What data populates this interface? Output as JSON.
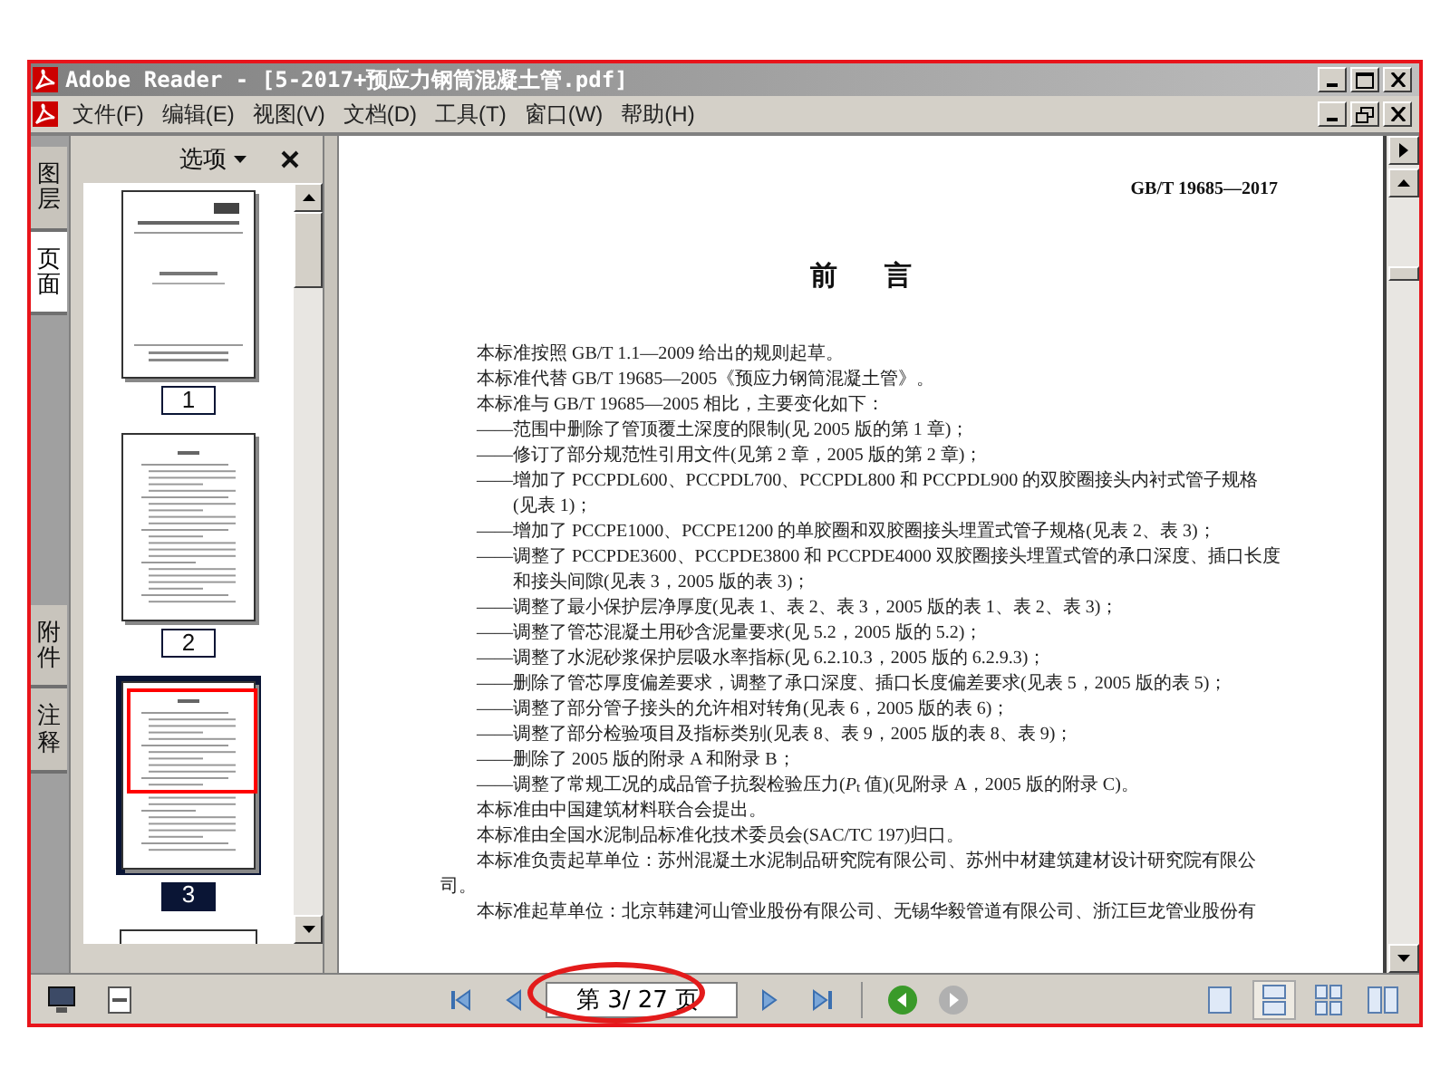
{
  "window": {
    "title": "Adobe Reader - [5-2017+预应力钢筒混凝土管.pdf]"
  },
  "menu": [
    "文件(F)",
    "编辑(E)",
    "视图(V)",
    "文档(D)",
    "工具(T)",
    "窗口(W)",
    "帮助(H)"
  ],
  "side_tabs": [
    {
      "label": "图层",
      "selected": false
    },
    {
      "label": "页面",
      "selected": true
    },
    {
      "label": "附件",
      "selected": false
    },
    {
      "label": "注释",
      "selected": false
    }
  ],
  "panel": {
    "options": "选项"
  },
  "thumbnails": [
    {
      "label": "1",
      "selected": false,
      "kind": "cover"
    },
    {
      "label": "2",
      "selected": false,
      "kind": "contents"
    },
    {
      "label": "3",
      "selected": true,
      "kind": "text"
    }
  ],
  "document": {
    "header": "GB/T 19685—2017",
    "title": "前 言",
    "paragraphs": [
      {
        "kind": "para",
        "text": "本标准按照 GB/T 1.1—2009 给出的规则起草。"
      },
      {
        "kind": "para",
        "text": "本标准代替 GB/T 19685—2005《预应力钢筒混凝土管》。"
      },
      {
        "kind": "para",
        "text": "本标准与 GB/T 19685—2005 相比，主要变化如下："
      },
      {
        "kind": "item",
        "text": "——范围中删除了管顶覆土深度的限制(见 2005 版的第 1 章)；"
      },
      {
        "kind": "item",
        "text": "——修订了部分规范性引用文件(见第 2 章，2005 版的第 2 章)；"
      },
      {
        "kind": "item",
        "text": "——增加了 PCCPDL600、PCCPDL700、PCCPDL800 和 PCCPDL900 的双胶圈接头内衬式管子规格(见表 1)；"
      },
      {
        "kind": "item",
        "text": "——增加了 PCCPE1000、PCCPE1200 的单胶圈和双胶圈接头埋置式管子规格(见表 2、表 3)；"
      },
      {
        "kind": "item",
        "text": "——调整了 PCCPDE3600、PCCPDE3800 和 PCCPDE4000 双胶圈接头埋置式管的承口深度、插口长度和接头间隙(见表 3，2005 版的表 3)；"
      },
      {
        "kind": "item",
        "text": "——调整了最小保护层净厚度(见表 1、表 2、表 3，2005 版的表 1、表 2、表 3)；"
      },
      {
        "kind": "item",
        "text": "——调整了管芯混凝土用砂含泥量要求(见 5.2，2005 版的 5.2)；"
      },
      {
        "kind": "item",
        "text": "——调整了水泥砂浆保护层吸水率指标(见 6.2.10.3，2005 版的 6.2.9.3)；"
      },
      {
        "kind": "item",
        "text": "——删除了管芯厚度偏差要求，调整了承口深度、插口长度偏差要求(见表 5，2005 版的表 5)；"
      },
      {
        "kind": "item",
        "text": "——调整了部分管子接头的允许相对转角(见表 6，2005 版的表 6)；"
      },
      {
        "kind": "item",
        "text": "——调整了部分检验项目及指标类别(见表 8、表 9，2005 版的表 8、表 9)；"
      },
      {
        "kind": "item",
        "text": "——删除了 2005 版的附录 A 和附录 B；"
      },
      {
        "kind": "item",
        "text": "——调整了常规工况的成品管子抗裂检验压力(*P*$_{t}$ 值)(见附录 A，2005 版的附录 C)。"
      },
      {
        "kind": "para",
        "text": "本标准由中国建筑材料联合会提出。"
      },
      {
        "kind": "para",
        "text": "本标准由全国水泥制品标准化技术委员会(SAC/TC 197)归口。"
      },
      {
        "kind": "para",
        "text": "本标准负责起草单位：苏州混凝土水泥制品研究院有限公司、苏州中材建筑建材设计研究院有限公司。"
      },
      {
        "kind": "para",
        "text": "本标准起草单位：北京韩建河山管业股份有限公司、无锡华毅管道有限公司、浙江巨龙管业股份有"
      }
    ]
  },
  "toolbar": {
    "page_field": "第 3/ 27 页",
    "history": [
      {
        "kind": "back",
        "disabled": false
      },
      {
        "kind": "forward",
        "disabled": true
      }
    ],
    "views": [
      {
        "kind": "single",
        "selected": false
      },
      {
        "kind": "continuous",
        "selected": true
      },
      {
        "kind": "grid",
        "selected": false
      },
      {
        "kind": "facing",
        "selected": false
      }
    ]
  }
}
